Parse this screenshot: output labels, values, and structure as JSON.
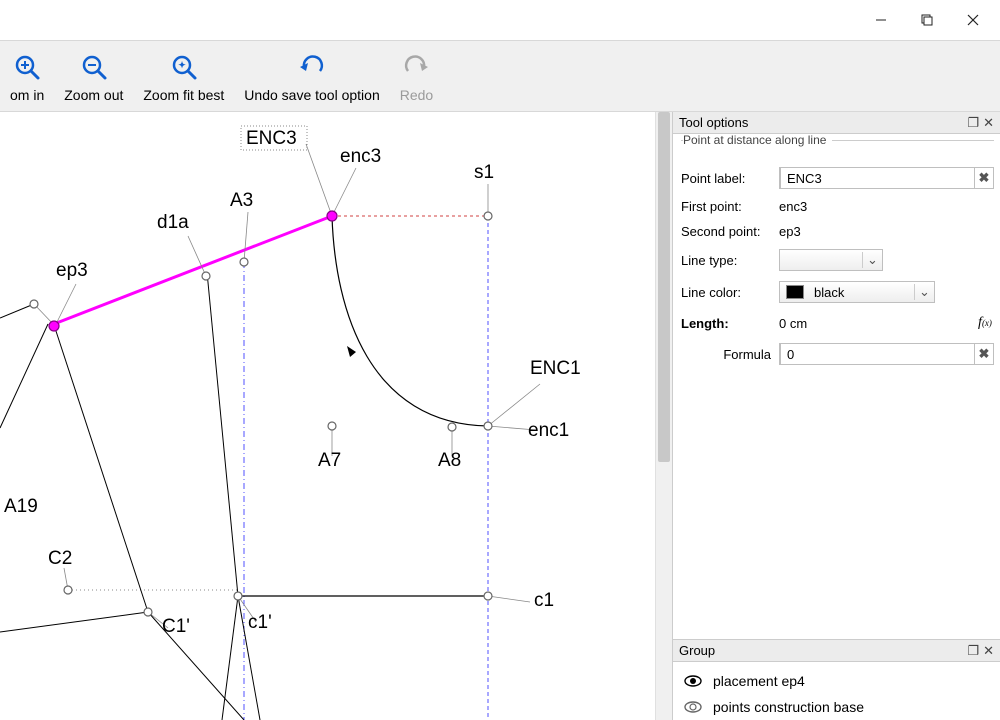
{
  "window_controls": {
    "minimize": "minimize",
    "maximize": "maximize",
    "close": "close"
  },
  "toolbar": {
    "zoom_in": {
      "label": "om in"
    },
    "zoom_out": {
      "label": "Zoom out"
    },
    "zoom_fit": {
      "label": "Zoom fit best"
    },
    "undo": {
      "label": "Undo save tool option"
    },
    "redo": {
      "label": "Redo"
    }
  },
  "canvas": {
    "labels": {
      "ENC3": "ENC3",
      "enc3": "enc3",
      "s1": "s1",
      "A3": "A3",
      "d1a": "d1a",
      "ep3": "ep3",
      "A7": "A7",
      "A8": "A8",
      "ENC1": "ENC1",
      "enc1": "enc1",
      "c1": "c1",
      "c1p": "c1'",
      "C1p": "C1'",
      "C2": "C2",
      "A19": "A19"
    }
  },
  "tool_options": {
    "panel_title": "Tool options",
    "subtitle": "Point at distance along line",
    "labels": {
      "point_label": "Point label:",
      "first_point": "First point:",
      "second_point": "Second point:",
      "line_type": "Line type:",
      "line_color": "Line color:",
      "length": "Length:",
      "formula": "Formula"
    },
    "values": {
      "point_label": "ENC3",
      "first_point": "enc3",
      "second_point": "ep3",
      "line_type": "",
      "line_color": "black",
      "length": "0 cm",
      "formula": "0"
    }
  },
  "group_panel": {
    "title": "Group",
    "items": [
      {
        "visible": true,
        "label": "placement ep4"
      },
      {
        "visible": true,
        "label": "points construction base"
      }
    ]
  }
}
